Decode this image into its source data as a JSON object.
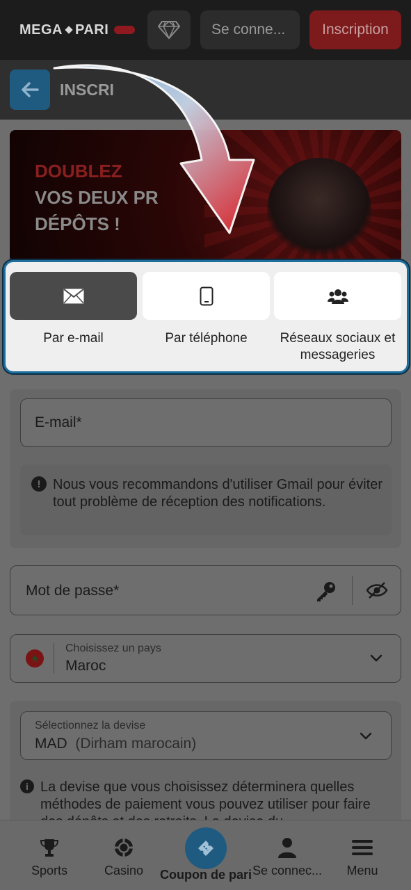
{
  "header": {
    "logo_left": "MEGA",
    "logo_right": "PARI",
    "login_label": "Se conne...",
    "signup_label": "Inscription"
  },
  "subheader": {
    "title": "INSCRI"
  },
  "banner": {
    "line1": "DOUBLEZ",
    "line2": "VOS DEUX PR",
    "line3": "DÉPÔTS !"
  },
  "registration_methods": [
    {
      "label": "Par e-mail",
      "icon": "envelope-icon",
      "selected": true
    },
    {
      "label": "Par téléphone",
      "icon": "phone-icon",
      "selected": false
    },
    {
      "label": "Réseaux sociaux et messageries",
      "icon": "users-icon",
      "selected": false
    }
  ],
  "form": {
    "email_placeholder": "E-mail*",
    "email_notice": "Nous vous recommandons d'utiliser Gmail pour éviter tout problème de réception des notifications.",
    "password_placeholder": "Mot de passe*",
    "country_label": "Choisissez un pays",
    "country_value": "Maroc",
    "currency_label": "Sélectionnez la devise",
    "currency_code": "MAD",
    "currency_name": "(Dirham marocain)",
    "currency_notice": "La devise que vous choisissez déterminera quelles méthodes de paiement vous pouvez utiliser pour faire des dépôts et des retraits. La devise du"
  },
  "bottom_nav": {
    "sports": "Sports",
    "casino": "Casino",
    "coupon": "Coupon de pari",
    "login": "Se connec...",
    "menu": "Menu"
  },
  "colors": {
    "accent_blue": "#1f5b80",
    "brand_red": "#7c1a1c",
    "highlight_border": "#1f6f9e"
  }
}
